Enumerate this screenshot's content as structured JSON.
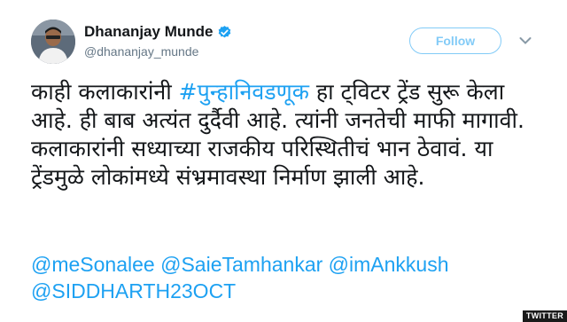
{
  "colors": {
    "accent": "#1da1f2",
    "text": "#14171a",
    "secondary": "#657786"
  },
  "author": {
    "display_name": "Dhananjay Munde",
    "handle": "@dhananjay_munde",
    "verified_icon": "verified-badge-icon",
    "avatar_icon": "profile-photo"
  },
  "header": {
    "follow_label": "Follow",
    "more_icon": "chevron-down-icon"
  },
  "tweet": {
    "line1_prefix": "काही कलाकारांनी ",
    "hashtag": "#पुन्हानिवडणूक",
    "line1_suffix": " हा ट्विटर ट्रेंड सुरू केला आहे. ही बाब अत्यंत दुर्दैवी आहे. त्यांनी जनतेची माफी मागावी. कलाकारांनी सध्याच्या राजकीय परिस्थितीचं भान ठेवावं. या ट्रेंडमुळे लोकांमध्ये संभ्रमावस्था निर्माण झाली आहे.",
    "mentions": [
      "@meSonalee",
      "@SaieTamhankar",
      "@imAnkkush",
      "@SIDDHARTH23OCT"
    ]
  },
  "watermark": {
    "label": "TWITTER"
  }
}
